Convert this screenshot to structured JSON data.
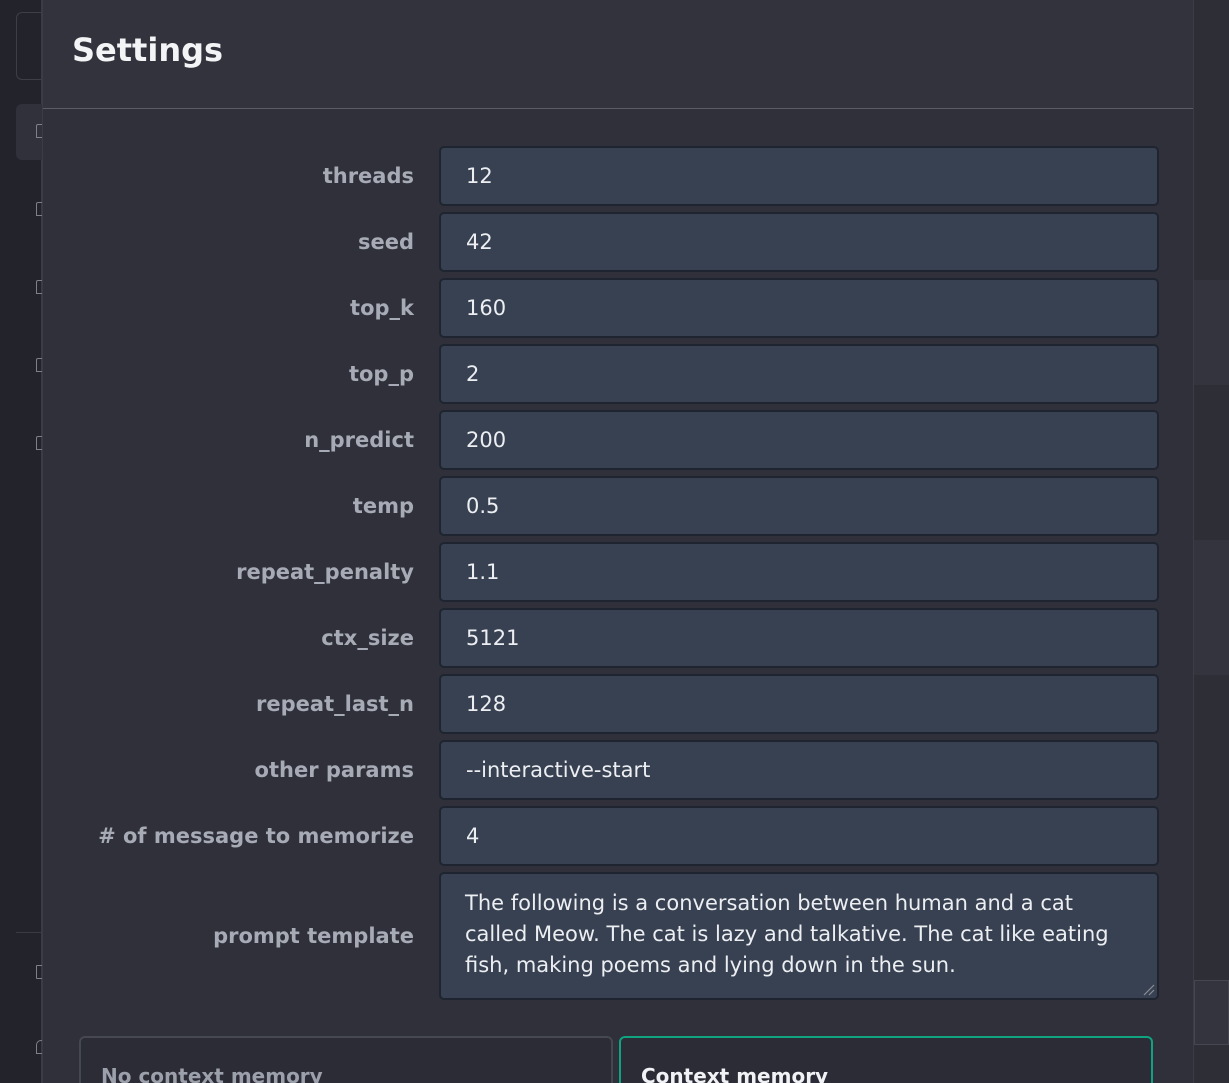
{
  "modal": {
    "title": "Settings"
  },
  "fields": [
    {
      "label": "threads",
      "value": "12"
    },
    {
      "label": "seed",
      "value": "42"
    },
    {
      "label": "top_k",
      "value": "160"
    },
    {
      "label": "top_p",
      "value": "2"
    },
    {
      "label": "n_predict",
      "value": "200"
    },
    {
      "label": "temp",
      "value": "0.5"
    },
    {
      "label": "repeat_penalty",
      "value": "1.1"
    },
    {
      "label": "ctx_size",
      "value": "5121"
    },
    {
      "label": "repeat_last_n",
      "value": "128"
    },
    {
      "label": "other params",
      "value": "--interactive-start"
    },
    {
      "label": "# of message to memorize",
      "value": "4"
    }
  ],
  "prompt_template": {
    "label": "prompt template",
    "value": "The following is a conversation between human and a cat called Meow. The cat is lazy and talkative. The cat like eating fish, making poems and lying down in the sun."
  },
  "memory_modes": {
    "no_context": "No context memory",
    "context": "Context memory",
    "selected": "context"
  },
  "colors": {
    "accent": "#10a37f",
    "input_bg": "#374151",
    "modal_bg": "#2f3039"
  },
  "icons": [
    "chat-bubble-icon",
    "trash-icon",
    "user-icon",
    "resize-grip-icon"
  ]
}
